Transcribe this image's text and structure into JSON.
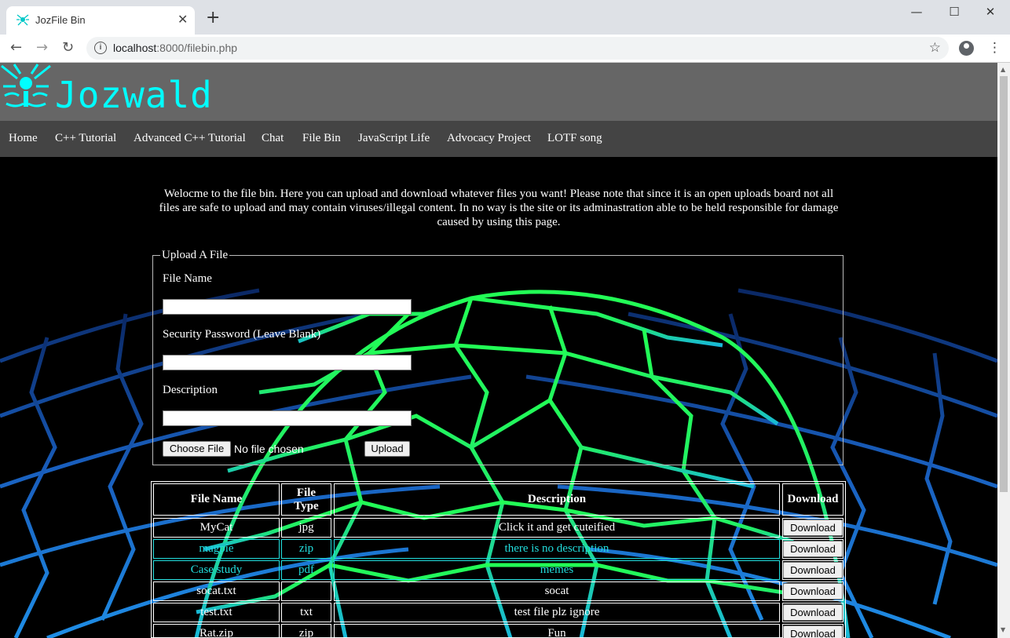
{
  "browser": {
    "tab_title": "JozFile Bin",
    "tab_close": "✕",
    "new_tab": "+",
    "window_controls": {
      "minimize": "—",
      "maximize": "☐",
      "close": "✕"
    },
    "url_host": "localhost",
    "url_rest": ":8000/filebin.php",
    "back": "←",
    "forward": "→",
    "reload": "↻",
    "star": "☆",
    "menu": "⋮"
  },
  "site": {
    "brand": "Jozwald",
    "nav": [
      "Home",
      "C++ Tutorial",
      "Advanced C++ Tutorial",
      "Chat",
      "File Bin",
      "JavaScript Life",
      "Advocacy Project",
      "LOTF song"
    ]
  },
  "intro": "Welocme to the file bin. Here you can upload and download whatever files you want! Please note that since it is an open uploads board not all files are safe to upload and may contain viruses/illegal content. In no way is the site or its adminastration able to be held responsible for damage caused by using this page.",
  "upload": {
    "legend": "Upload A File",
    "file_name_label": "File Name",
    "password_label": "Security Password (Leave Blank)",
    "description_label": "Description",
    "choose_file": "Choose File",
    "no_file": "No file chosen",
    "upload_button": "Upload"
  },
  "table": {
    "headers": [
      "File Name",
      "File Type",
      "Description",
      "Download"
    ],
    "download_label": "Download",
    "link_color": "#22dddd",
    "rows": [
      {
        "name": "MyCat",
        "type": "jpg",
        "description": "Click it and get cuteified",
        "color": "#ffffff"
      },
      {
        "name": "magpie",
        "type": "zip",
        "description": "there is no description",
        "color": "#22dddd"
      },
      {
        "name": "Case study",
        "type": "pdf",
        "description": "memes",
        "color": "#22dddd"
      },
      {
        "name": "socat.txt",
        "type": "",
        "description": "socat",
        "color": "#ffffff"
      },
      {
        "name": "test.txt",
        "type": "txt",
        "description": "test file plz ignore",
        "color": "#ffffff"
      },
      {
        "name": "Rat.zip",
        "type": "zip",
        "description": "Fun",
        "color": "#ffffff"
      }
    ]
  },
  "colors": {
    "brand": "#00ffff",
    "header_bg": "#666666",
    "nav_bg": "#444444",
    "page_bg": "#000000"
  }
}
